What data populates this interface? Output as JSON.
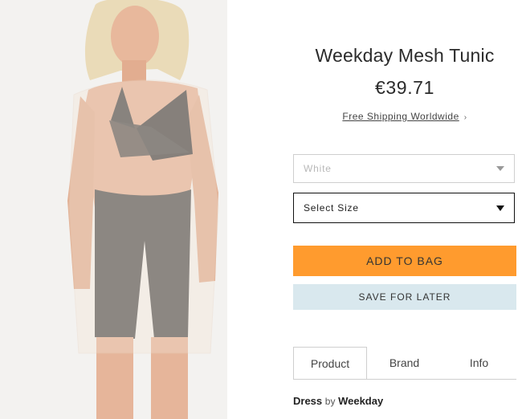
{
  "product": {
    "title": "Weekday Mesh Tunic",
    "price": "€39.71",
    "shipping_text": "Free Shipping Worldwide",
    "shipping_chevron": "›"
  },
  "options": {
    "colour_value": "White",
    "size_placeholder": "Select Size"
  },
  "actions": {
    "add_to_bag": "ADD TO BAG",
    "save_for_later": "SAVE FOR LATER"
  },
  "tabs": [
    {
      "label": "Product",
      "active": true
    },
    {
      "label": "Brand",
      "active": false
    },
    {
      "label": "Info",
      "active": false
    }
  ],
  "description": {
    "category": "Dress",
    "by": "by",
    "brand": "Weekday"
  },
  "colors": {
    "accent_orange": "#ff9b2e",
    "save_blue": "#d9e8ee"
  },
  "icons": {
    "select_caret": "chevron-down-icon"
  }
}
